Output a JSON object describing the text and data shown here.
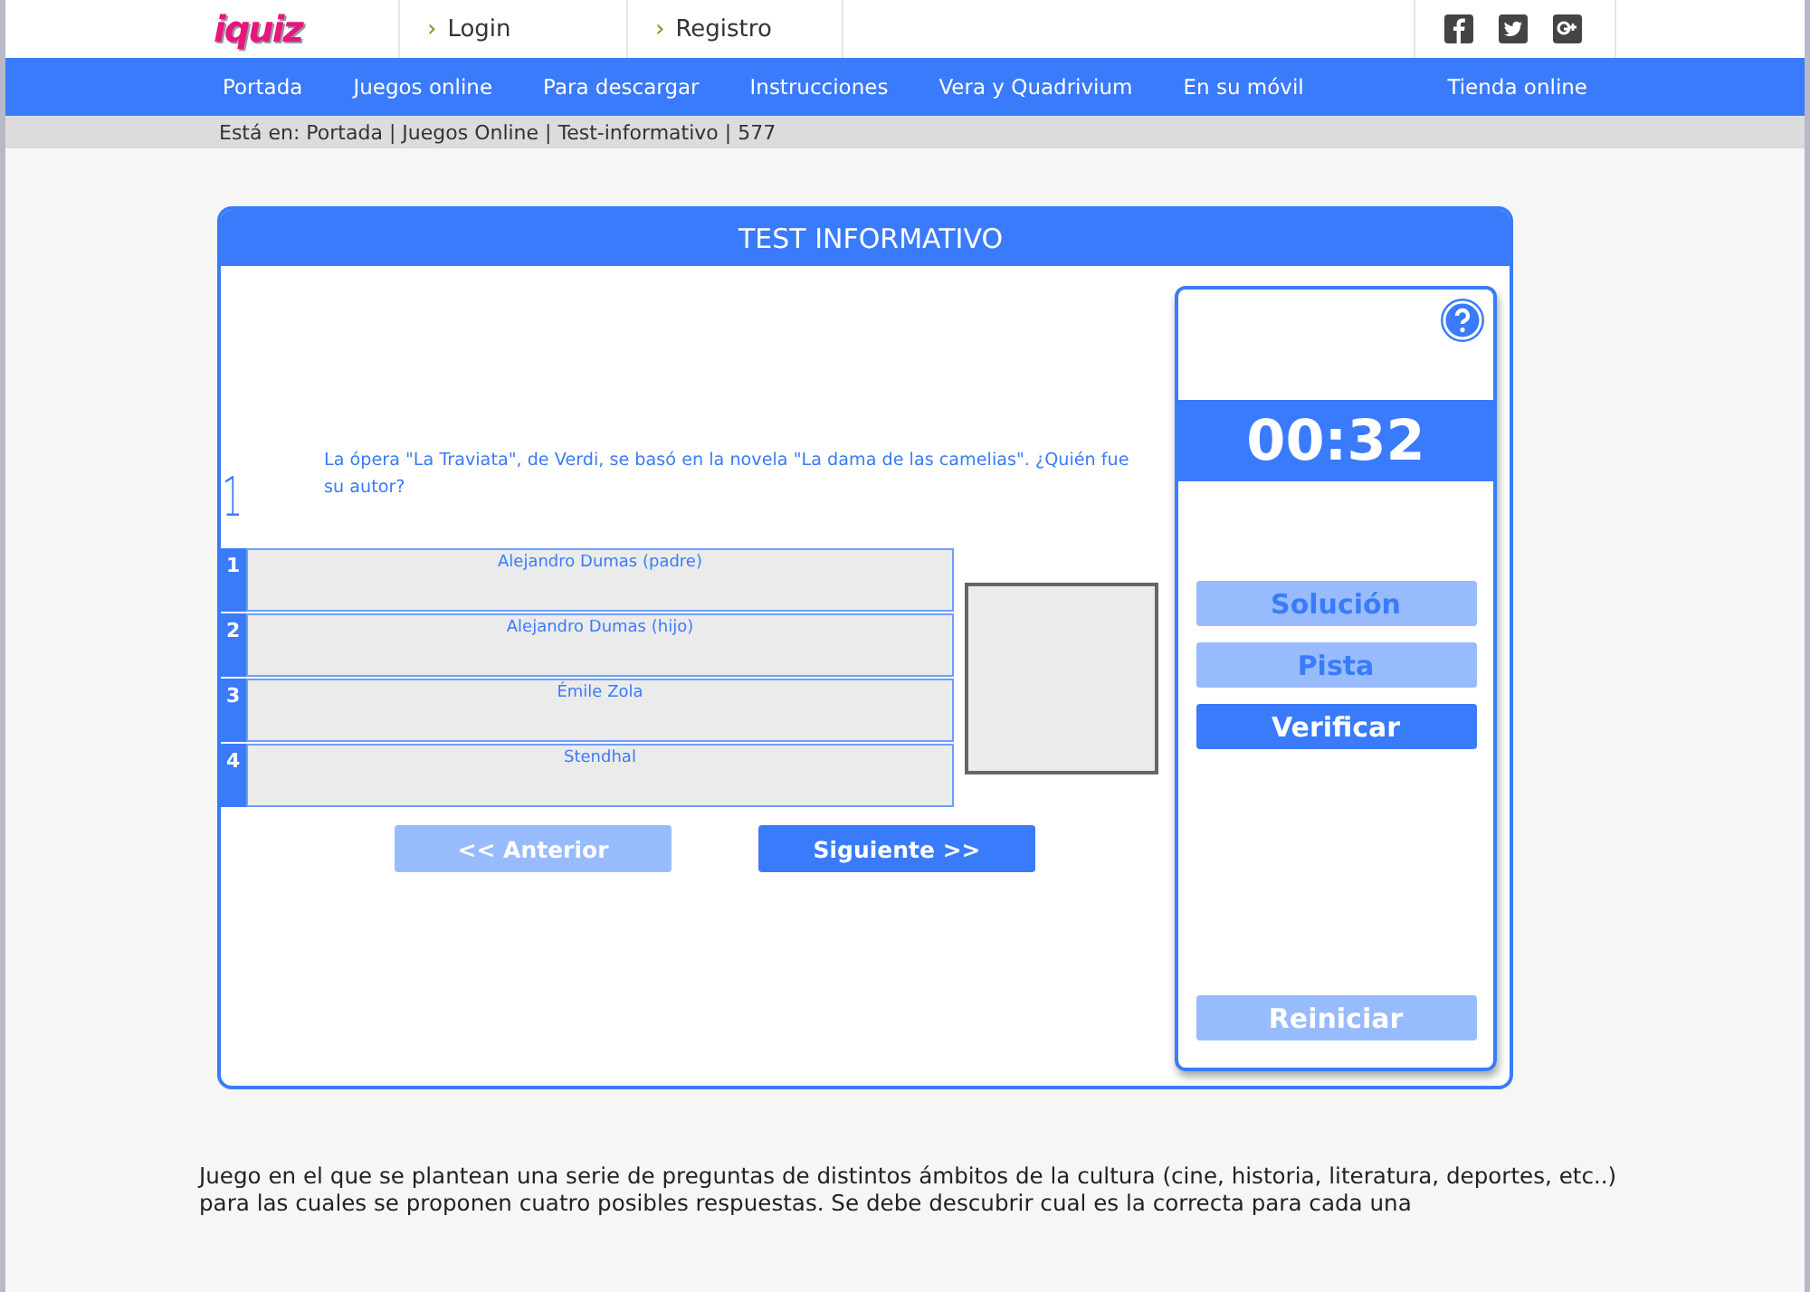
{
  "header": {
    "logo": "iquiz",
    "links": [
      {
        "marker": "›",
        "label": "Login"
      },
      {
        "marker": "›",
        "label": "Registro"
      }
    ]
  },
  "nav": {
    "items": [
      {
        "label": "Portada"
      },
      {
        "label": "Juegos online"
      },
      {
        "label": "Para descargar"
      },
      {
        "label": "Instrucciones"
      },
      {
        "label": "Vera y Quadrivium"
      },
      {
        "label": "En su móvil"
      }
    ],
    "right_item": {
      "label": "Tienda online"
    }
  },
  "breadcrumb": "Está en: Portada | Juegos Online | Test-informativo | 577",
  "quiz": {
    "title": "TEST INFORMATIVO",
    "question_number": "1",
    "question": "La ópera \"La Traviata\", de Verdi, se basó en la novela \"La dama de las camelias\". ¿Quién fue su autor?",
    "answers": [
      {
        "number": "1",
        "text": "Alejandro Dumas (padre)"
      },
      {
        "number": "2",
        "text": "Alejandro Dumas (hijo)"
      },
      {
        "number": "3",
        "text": "Émile Zola"
      },
      {
        "number": "4",
        "text": "Stendhal"
      }
    ],
    "nav_buttons": [
      {
        "label": "<< Anterior",
        "disabled": true
      },
      {
        "label": "Siguiente >>",
        "disabled": false
      }
    ],
    "side": {
      "timer": "00:32",
      "buttons": [
        {
          "label": "Solución",
          "disabled": true
        },
        {
          "label": "Pista",
          "disabled": true
        },
        {
          "label": "Verificar",
          "disabled": false
        }
      ],
      "reset_button": {
        "label": "Reiniciar",
        "disabled": true
      }
    }
  },
  "description": "Juego en el que se plantean una serie de preguntas de distintos ámbitos de la cultura (cine, historia, literatura, deportes, etc..) para las cuales se proponen cuatro posibles respuestas. Se debe descubrir cual es la correcta para cada una"
}
